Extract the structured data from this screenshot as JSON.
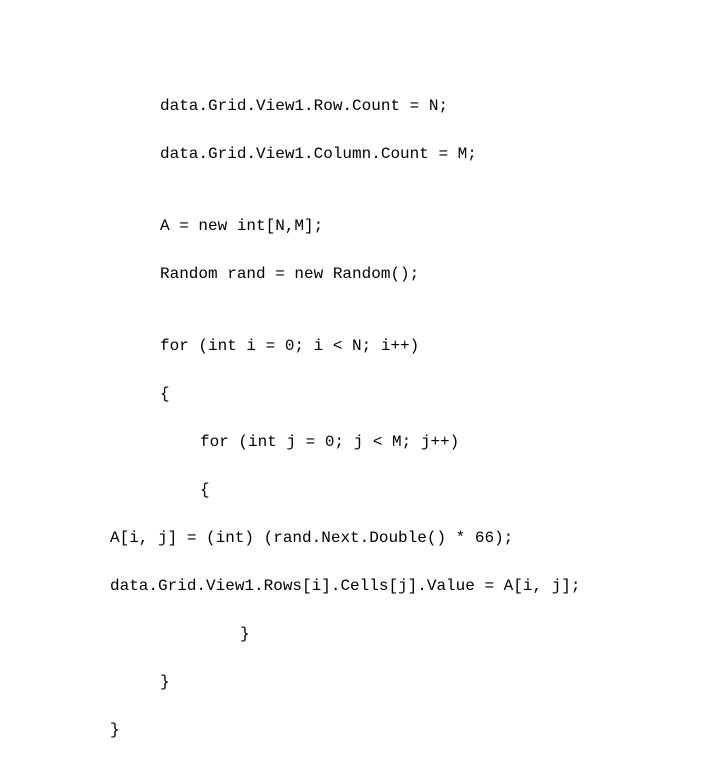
{
  "code": {
    "l1": "data.Grid.View1.Row.Count = N;",
    "l2": "data.Grid.View1.Column.Count = M;",
    "l3": "",
    "l4": "A = new int[N,M];",
    "l5": "Random rand = new Random();",
    "l6": "",
    "l7": "for (int i = 0; i < N; i++)",
    "l8": "{",
    "l9": "for (int j = 0; j < M; j++)",
    "l10": "{",
    "l11": "A[i, j] = (int) (rand.Next.Double() * 66);",
    "l12": "data.Grid.View1.Rows[i].Cells[j].Value = A[i, j];",
    "l13": "}",
    "l14": "}",
    "l15": "}"
  }
}
